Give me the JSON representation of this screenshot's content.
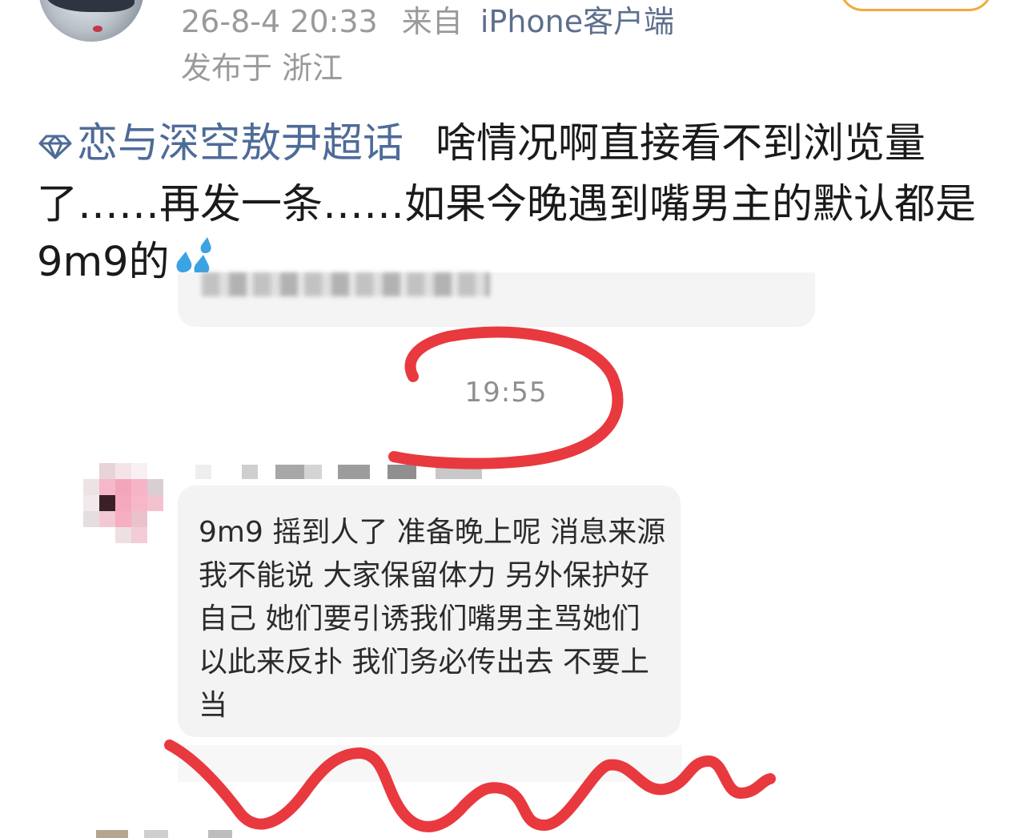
{
  "post": {
    "timestamp": "26-8-4 20:33",
    "source_prefix": "来自",
    "source": "iPhone客户端",
    "location": "发布于 浙江",
    "topic": "恋与深空敖尹超话",
    "body": "啥情况啊直接看不到浏览量了……再发一条……如果今晚遇到嘴男主的默认都是9m9的"
  },
  "chat": {
    "time": "19:55",
    "message_lines": [
      "9m9 摇到人了 准备晚上呢 消息来源",
      "我不能说 大家保留体力 另外保护好",
      "自己 她们要引诱我们嘴男主骂她们",
      "以此来反扑 我们务必传出去 不要上",
      "当"
    ]
  },
  "colors": {
    "topic": "#4e6b98",
    "annotation": "#e8393f",
    "follow_border": "#f3a93c"
  },
  "icons": {
    "topic": "diamond-icon",
    "emoji": "sweat-drops-icon"
  }
}
